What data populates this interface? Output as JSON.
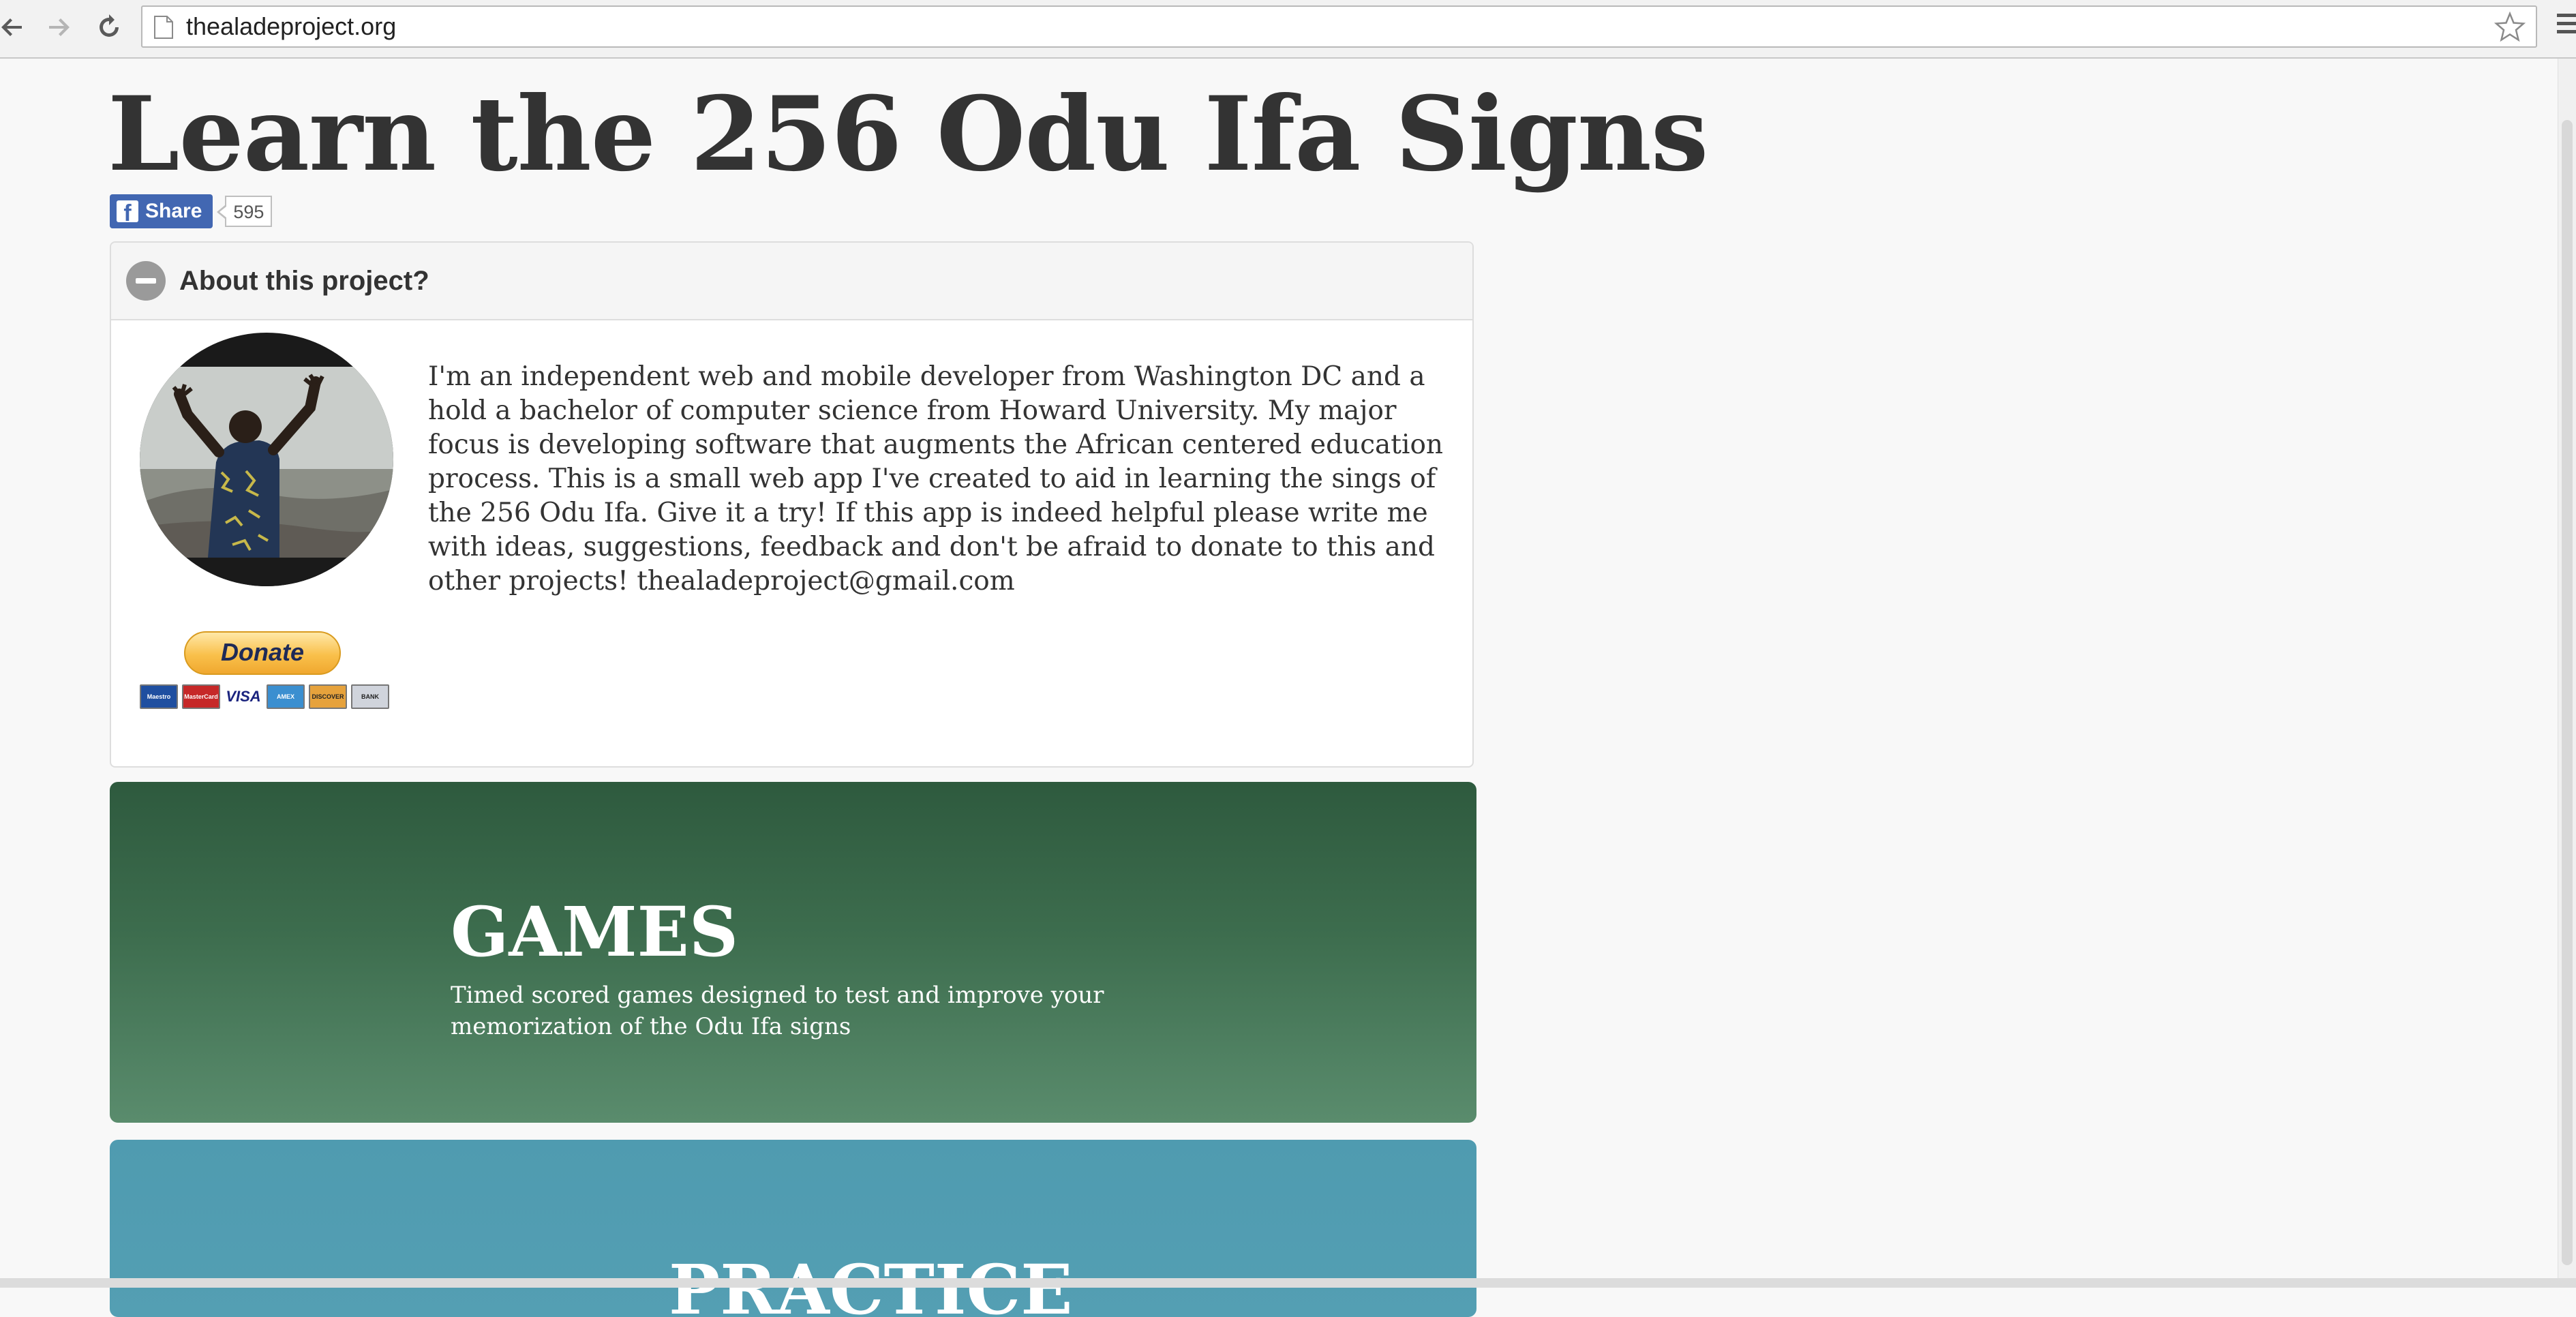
{
  "browser": {
    "url": "thealadeproject.org"
  },
  "page": {
    "title": "Learn the 256 Odu Ifa Signs",
    "share": {
      "label": "Share",
      "count": "595"
    },
    "about": {
      "heading": "About this project?",
      "text": "I'm an independent web and mobile developer from Washington DC and a hold a bachelor of computer science from Howard University. My major focus is developing software that augments the African centered education process. This is a small web app I've created to aid in learning the sings of the 256 Odu Ifa. Give it a try! If this app is indeed helpful please write me with ideas, suggestions, feedback and don't be afraid to donate to this and other projects! thealadeproject@gmail.com",
      "donate_label": "Donate",
      "cards": [
        "Maestro",
        "MasterCard",
        "VISA",
        "AMEX",
        "DISCOVER",
        "BANK"
      ]
    },
    "games": {
      "title": "GAMES",
      "description": "Timed scored games designed to test and improve your memorization of the Odu Ifa signs"
    },
    "practice": {
      "title": "PRACTICE"
    }
  },
  "colors": {
    "facebook_blue": "#4267b2",
    "games_green": "#3d6d4e",
    "practice_blue": "#4f9bb0",
    "title_text": "#333333"
  }
}
